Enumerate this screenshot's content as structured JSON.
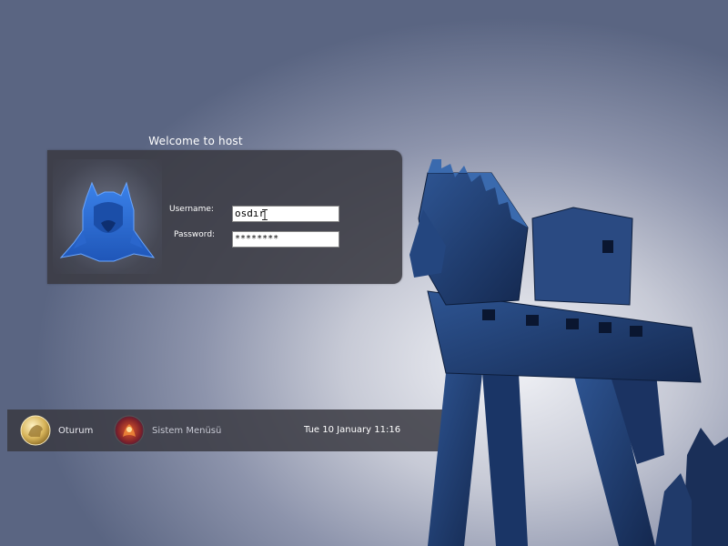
{
  "header": {
    "welcome_text": "Welcome to host"
  },
  "login": {
    "username_label": "Username:",
    "username_value": "osdır",
    "password_label": "Password:",
    "password_value": "********"
  },
  "bottom_bar": {
    "session_label": "Oturum",
    "system_menu_label": "Sistem Menüsü",
    "clock": "Tue 10 January 11:16"
  },
  "icons": {
    "logo": "pardus-cat-logo-icon",
    "session": "session-coin-icon",
    "system_menu": "system-menu-icon"
  },
  "colors": {
    "panel": "#3a3a42",
    "logo_blue": "#2f6fd6",
    "horse_blue": "#1d3a6e"
  }
}
